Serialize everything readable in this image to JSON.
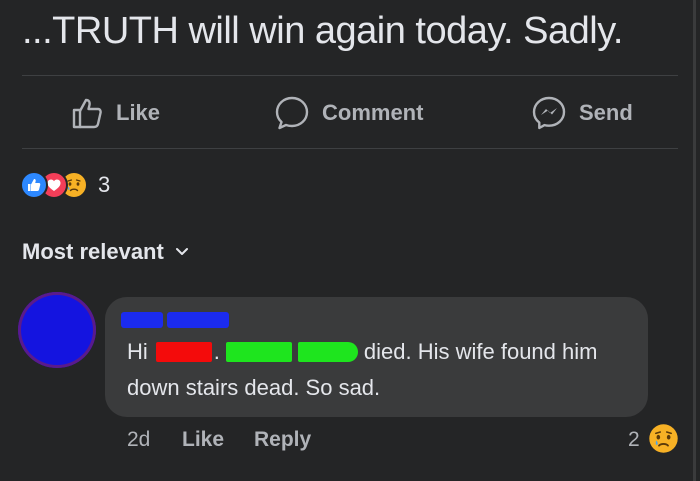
{
  "post": {
    "text": "...TRUTH will win again today. Sadly."
  },
  "actions": {
    "like_label": "Like",
    "comment_label": "Comment",
    "send_label": "Send"
  },
  "reactions": {
    "types": [
      "like",
      "love",
      "sad"
    ],
    "count": "3"
  },
  "sort": {
    "label": "Most relevant"
  },
  "comment": {
    "greeting": "Hi",
    "dot": ".",
    "text_after_redaction": "died. His wife found him",
    "text_line2": "down stairs dead. So sad.",
    "time": "2d",
    "like_label": "Like",
    "reply_label": "Reply",
    "reaction_count": "2"
  },
  "colors": {
    "background": "#242526",
    "bubble": "#3a3b3c",
    "text_primary": "#e4e6eb",
    "text_secondary": "#b0b3b8",
    "like_blue": "#2d88ff",
    "love_red": "#f33e58",
    "sad_yellow": "#f7b125",
    "redaction_red": "#f40b0b",
    "redaction_green": "#1ee51e",
    "redaction_blue": "#1b2bef"
  },
  "icons": {
    "like": "thumbs-up-outline-icon",
    "comment": "speech-bubble-outline-icon",
    "send": "messenger-icon",
    "sort": "chevron-down-icon",
    "sad": "crying-face-icon"
  }
}
